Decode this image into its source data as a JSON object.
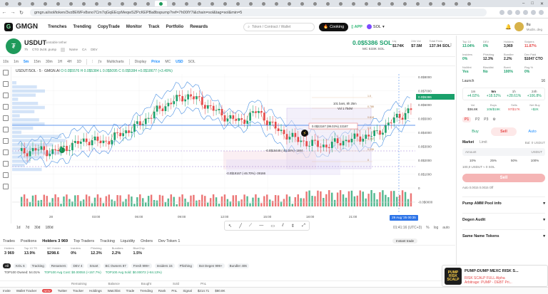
{
  "browser": {
    "url": "gmgn.ai/sol/token/3vz8EWFv8sno7Cm7qGqEEcpMeqwSZPcKEPBa8bspump?ref=7h00lY7i&chain=sol&tag=sol&min=5"
  },
  "nav": {
    "brand": "GMGN",
    "links": [
      "Trenches",
      "Trending",
      "CopyTrade",
      "Monitor",
      "Track",
      "Portfolio",
      "Rewards"
    ],
    "search_placeholder": "Token / Contract / Wallet",
    "cooking": "Cooking",
    "app": "APP",
    "chain": "SOL",
    "account_name": "Ilu",
    "account_sub": "Mudin..deg"
  },
  "token": {
    "symbol": "USDUT",
    "full_name": "unstable tether",
    "age": "7h",
    "meta": [
      "CTO 3vz8..pump",
      "Name",
      "CA",
      "DEV"
    ],
    "price": "0.0$5386 SOL",
    "mc": "MC 533K SOL",
    "stats": [
      {
        "k": "Liq",
        "v": "$174K"
      },
      {
        "k": "24h Vol",
        "v": "$7.5M"
      },
      {
        "k": "Total Fees",
        "v": "137.94 SOL"
      }
    ]
  },
  "chart_toolbar": {
    "timeframes": [
      "10s",
      "1m",
      "5m",
      "15m",
      "30m",
      "1H",
      "4H",
      "1D"
    ],
    "active": "5m",
    "items": [
      "Multicharts",
      "Display",
      "Price",
      "MC",
      "USD",
      "SOL"
    ]
  },
  "chart": {
    "legend_prefix": "USDUT/SOL · 5 · GMGN.AI",
    "ohlc": "O 0.0$5576 H 0.0$5384 L 0.0$5095 C 0.0$5384 +0.0$18677 (+3.49%)",
    "x_ticks": [
      "28",
      "03:00",
      "06:00",
      "09:00",
      "12:00",
      "15:00",
      "18:00",
      "21:00",
      "29 Aug '25",
      "00:35"
    ],
    "y_ticks": [
      "0.0$8000",
      "0.0$7000",
      "0.0$6000",
      "0.0$5000",
      "0.0$4000",
      "0.0$3000",
      "0.0$2000",
      "0.0$1000",
      "0",
      "-0.0$0000"
    ],
    "current_price_label": "0.0$5386",
    "annotations": [
      "101 bars, 8h 25m",
      "Vol 1.754M",
      "0.0$22187 (99.03%) 22187",
      "-0.0$18448 (-33.15%) -1844",
      "-0.0$19167 (-46.70%) -39166"
    ],
    "fib_labels": [
      "1.0",
      "0.786",
      "0.618",
      "0.5",
      "0.382",
      "0.236",
      "0"
    ]
  },
  "chart_data": {
    "type": "candlestick",
    "title": "USDUT/SOL · 5 · GMGN.AI",
    "x_ticks": [
      "28",
      "03:00",
      "06:00",
      "09:00",
      "12:00",
      "15:00",
      "18:00",
      "21:00",
      "29 Aug '25"
    ],
    "ylim": [
      1e-06,
      8e-05
    ],
    "y_unit": "SOL",
    "close_series": [
      1.8e-05,
      2.1e-05,
      1.9e-05,
      2.4e-05,
      2.9e-05,
      2.7e-05,
      3.4e-05,
      4.1e-05,
      5.2e-05,
      6.1e-05,
      6.6e-05,
      5.8e-05,
      4.9e-05,
      4.4e-05,
      5.3e-05,
      3.9e-05,
      3.1e-05,
      2.6e-05,
      2.4e-05,
      2.8e-05,
      3.1e-05,
      3.4e-05,
      4.6e-05,
      5.4e-05
    ]
  },
  "chart_bottom": {
    "ranges": [
      "1d",
      "7d",
      "30d",
      "180d"
    ],
    "time": "01:41:16 (UTC+3)",
    "opts": [
      "%",
      "log",
      "auto"
    ],
    "date_badge": "29 Aug '25  00:35"
  },
  "bottom": {
    "tabs": [
      "Trades",
      "Positions",
      "Holders 3 969",
      "Top Traders",
      "Tracking",
      "Liquidity",
      "Orders",
      "Dev Token 1"
    ],
    "active_tab": "Holders 3 969",
    "instant_trade": "Instant trade",
    "holder_stats": [
      {
        "k": "Holders",
        "v": "3 969"
      },
      {
        "k": "Top 10 TS",
        "v": "13.9%"
      },
      {
        "k": "MC Holder",
        "v": "$298.6"
      },
      {
        "k": "Insiders",
        "v": "0%"
      },
      {
        "k": "Phishing",
        "v": "12.3%"
      },
      {
        "k": "Bundlers",
        "v": "2.2%"
      },
      {
        "k": "BlueChip",
        "v": "1.5%"
      }
    ],
    "filters": [
      "All",
      "KOL 6",
      "Tracking",
      "Renamers",
      "DEV 4",
      "Smart",
      "BC Owners 87",
      "Fresh 999+",
      "Insiders 15",
      "Phishing",
      "Bot Degen 999+",
      "Bundler 406"
    ],
    "top_row": [
      "TOP100 Owned: 54.01%",
      "TOP100 Avg Cost: $0.0005S (+157.7%)",
      "TOP100 Avg Sold: $0.00072 (+84.13%)"
    ],
    "table_head": [
      "Remaining",
      "Balance",
      "Bought",
      "Sold",
      "PnL"
    ]
  },
  "sidebar": {
    "metrics": [
      {
        "k": "Top 10",
        "v": "13.04%",
        "c": "g"
      },
      {
        "k": "DEV",
        "v": "0%",
        "c": "g"
      },
      {
        "k": "Holders",
        "v": "3,969",
        "c": ""
      },
      {
        "k": "Snipers",
        "v": "11.87%",
        "c": "r"
      },
      {
        "k": "Insiders",
        "v": "0%",
        "c": "g"
      },
      {
        "k": "Phishing",
        "v": "12.3%",
        "c": ""
      },
      {
        "k": "Bundler",
        "v": "2.2%",
        "c": ""
      },
      {
        "k": "Dex Paid",
        "v": "$1047 CTO",
        "c": ""
      },
      {
        "k": "NoMint",
        "v": "Yes",
        "c": "g"
      },
      {
        "k": "Blacklist",
        "v": "No",
        "c": "g"
      },
      {
        "k": "Burnt",
        "v": "100%",
        "c": "g"
      },
      {
        "k": "Rug %",
        "v": "0%",
        "c": "g"
      }
    ],
    "launch_label": "Launch",
    "launch_value": "16",
    "timeframes": [
      {
        "k": "1m",
        "v": "+4.02%"
      },
      {
        "k": "5m",
        "v": "+18.52%"
      },
      {
        "k": "1h",
        "v": "+28.61%"
      },
      {
        "k": "24h",
        "v": "+106.8%"
      }
    ],
    "tf_active": "5m",
    "tf_row2": [
      {
        "k": "Vol",
        "v": "$36.8K"
      },
      {
        "k": "Buys",
        "v": "108/$19K"
      },
      {
        "k": "Sells",
        "v": "97/$17K"
      },
      {
        "k": "Net Buy",
        "v": "+$2K"
      }
    ],
    "presets": [
      "P1",
      "P2",
      "P3"
    ],
    "preset_active": "P1",
    "buy": "Buy",
    "sell": "Sell",
    "auto": "Auto",
    "market": "Market",
    "limit": "Limit",
    "balance": "Bal: 0 USDUT",
    "amount_label": "Amount",
    "amount_unit": "USDUT",
    "pcts": [
      "10%",
      "25%",
      "50%",
      "100%"
    ],
    "eq": "100,0 USDUT ≈ 0 SOL",
    "sell_button": "Sell",
    "slip": "Auto  0.0015  0.0015  Off",
    "sections": [
      "Pump AMM Pool info",
      "Degen Audit",
      "Same Name Tokens"
    ]
  },
  "popup": {
    "img_text": "PUMP RISK SCALP",
    "title": "PUMP-DUMP MEXC RISK S...",
    "sub1": "RISK SCALP FULL Alpha",
    "sub2": "Arbitrage: PUMP - DEBT Pri..."
  },
  "statusbar": {
    "items": [
      "Invite",
      "Wallet Tracker",
      "Twitter",
      "Tracker",
      "Holdings",
      "Watchlist",
      "Trade",
      "Trending",
      "Rank",
      "PnL",
      "Signal",
      "$214.71",
      "$80.8K"
    ]
  }
}
